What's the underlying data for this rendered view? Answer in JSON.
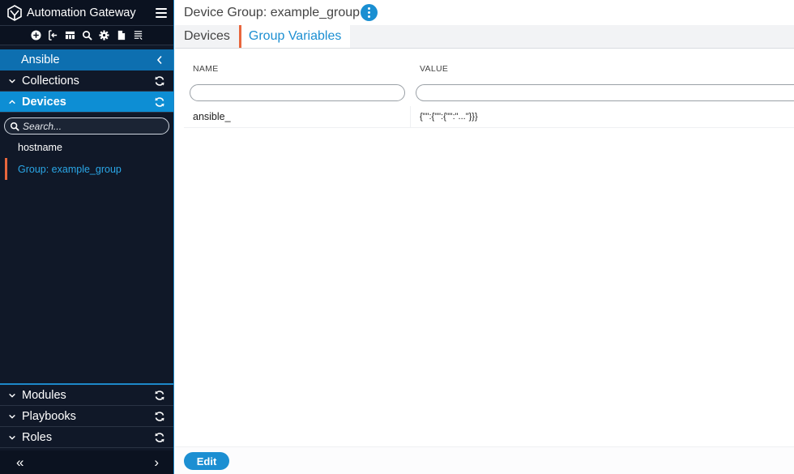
{
  "app": {
    "title": "Automation Gateway"
  },
  "toolbar": {
    "icons": [
      "add-icon",
      "import-icon",
      "grid-icon",
      "search-icon",
      "gear-icon",
      "file-icon",
      "notes-icon"
    ]
  },
  "sidebar": {
    "ansible_label": "Ansible",
    "sections": {
      "collections": "Collections",
      "devices": "Devices",
      "modules": "Modules",
      "playbooks": "Playbooks",
      "roles": "Roles"
    },
    "search_placeholder": "Search...",
    "devices_tree": [
      {
        "label": "hostname",
        "selected": false
      },
      {
        "label": "Group: example_group",
        "selected": true
      }
    ],
    "collapse_left": "«",
    "collapse_right": "›"
  },
  "page": {
    "title": "Device Group: example_group",
    "tabs": [
      {
        "label": "Devices",
        "active": false
      },
      {
        "label": "Group Variables",
        "active": true
      }
    ]
  },
  "table": {
    "columns": {
      "name": "NAME",
      "value": "VALUE"
    },
    "filters": {
      "name": "",
      "value": ""
    },
    "rows": [
      {
        "name": "ansible_",
        "value": "{\"\":{\"\":{\"\":\"...\"}}}"
      }
    ]
  },
  "footer": {
    "edit_label": "Edit"
  },
  "colors": {
    "sidebar_bg": "#101828",
    "accent_blue": "#1c8fd2",
    "active_section": "#0d8ed4",
    "ansible_bar": "#0d6fb0",
    "selection_marker": "#e8663d"
  }
}
